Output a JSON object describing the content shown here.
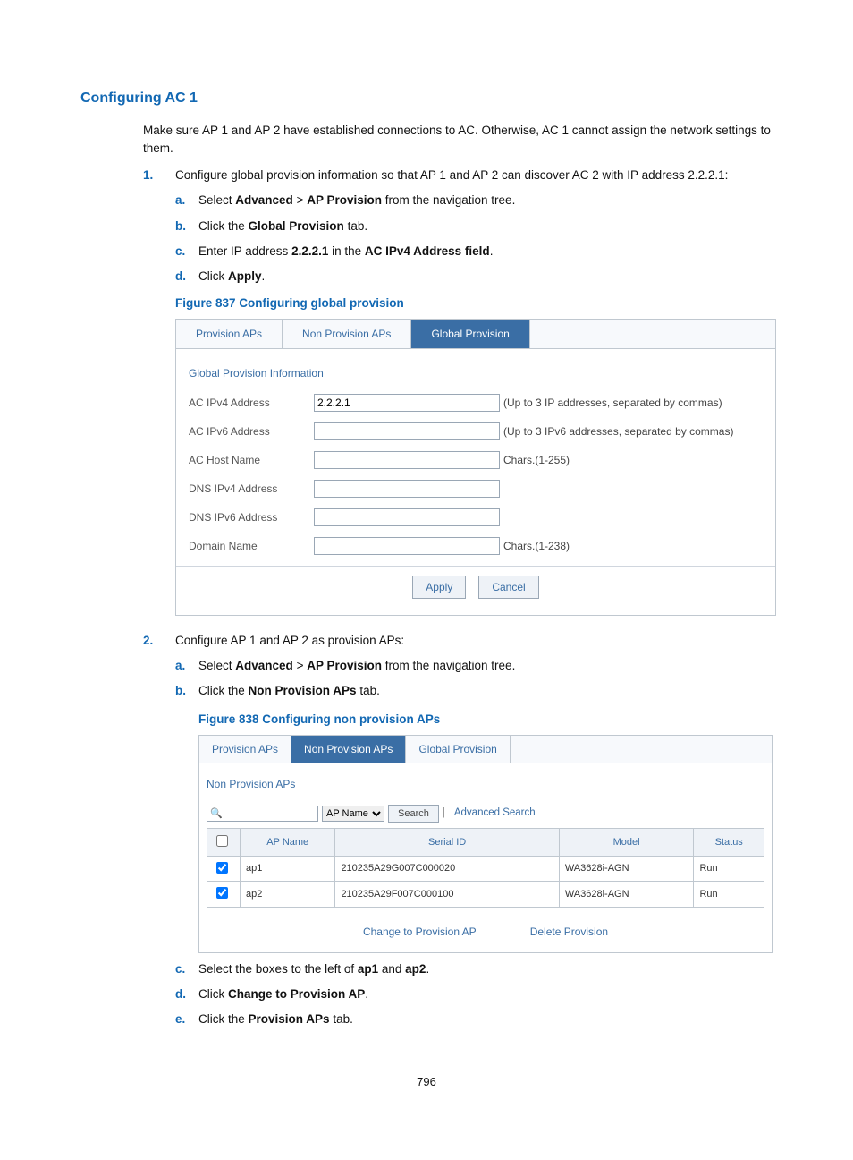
{
  "section_heading": "Configuring AC 1",
  "intro": "Make sure AP 1 and AP 2 have established connections to AC. Otherwise, AC 1 cannot assign the network settings to them.",
  "step1": {
    "num": "1.",
    "text": "Configure global provision information so that AP 1 and AP 2 can discover AC 2 with IP address 2.2.2.1:",
    "a": {
      "m": "a.",
      "pre": "Select ",
      "b1": "Advanced",
      "mid": " > ",
      "b2": "AP Provision",
      "post": " from the navigation tree."
    },
    "b": {
      "m": "b.",
      "pre": "Click the ",
      "b1": "Global Provision",
      "post": " tab."
    },
    "c": {
      "m": "c.",
      "pre": "Enter IP address ",
      "b1": "2.2.2.1",
      "mid": " in the ",
      "b2": "AC IPv4 Address field",
      "post": "."
    },
    "d": {
      "m": "d.",
      "pre": "Click ",
      "b1": "Apply",
      "post": "."
    },
    "figcap": "Figure 837 Configuring global provision"
  },
  "fig837": {
    "tabs": {
      "t1": "Provision APs",
      "t2": "Non Provision APs",
      "t3": "Global Provision"
    },
    "section": "Global Provision Information",
    "rows": {
      "ipv4": {
        "label": "AC IPv4 Address",
        "value": "2.2.2.1",
        "hint": "(Up to 3 IP addresses, separated by commas)"
      },
      "ipv6": {
        "label": "AC IPv6 Address",
        "value": "",
        "hint": "(Up to 3 IPv6 addresses, separated by commas)"
      },
      "host": {
        "label": "AC Host Name",
        "value": "",
        "hint": "Chars.(1-255)"
      },
      "dns4": {
        "label": "DNS IPv4 Address",
        "value": "",
        "hint": ""
      },
      "dns6": {
        "label": "DNS IPv6 Address",
        "value": "",
        "hint": ""
      },
      "domain": {
        "label": "Domain Name",
        "value": "",
        "hint": "Chars.(1-238)"
      }
    },
    "apply": "Apply",
    "cancel": "Cancel"
  },
  "step2": {
    "num": "2.",
    "text": "Configure AP 1 and AP 2 as provision APs:",
    "a": {
      "m": "a.",
      "pre": "Select ",
      "b1": "Advanced",
      "mid": " > ",
      "b2": "AP Provision",
      "post": " from the navigation tree."
    },
    "b": {
      "m": "b.",
      "pre": "Click the ",
      "b1": "Non Provision APs",
      "post": " tab."
    },
    "figcap": "Figure 838 Configuring non provision APs"
  },
  "fig838": {
    "tabs": {
      "t1": "Provision APs",
      "t2": "Non Provision APs",
      "t3": "Global Provision"
    },
    "section": "Non Provision APs",
    "search_select": "AP Name",
    "search_btn": "Search",
    "adv": "Advanced Search",
    "headers": {
      "name": "AP Name",
      "serial": "Serial ID",
      "model": "Model",
      "status": "Status"
    },
    "rows": [
      {
        "name": "ap1",
        "serial": "210235A29G007C000020",
        "model": "WA3628i-AGN",
        "status": "Run"
      },
      {
        "name": "ap2",
        "serial": "210235A29F007C000100",
        "model": "WA3628i-AGN",
        "status": "Run"
      }
    ],
    "change": "Change to Provision AP",
    "delete": "Delete Provision"
  },
  "step2c": {
    "m": "c.",
    "pre": "Select the boxes to the left of ",
    "b1": "ap1",
    "mid": " and ",
    "b2": "ap2",
    "post": "."
  },
  "step2d": {
    "m": "d.",
    "pre": "Click ",
    "b1": "Change to Provision AP",
    "post": "."
  },
  "step2e": {
    "m": "e.",
    "pre": "Click the ",
    "b1": "Provision APs",
    "post": " tab."
  },
  "pagenum": "796"
}
